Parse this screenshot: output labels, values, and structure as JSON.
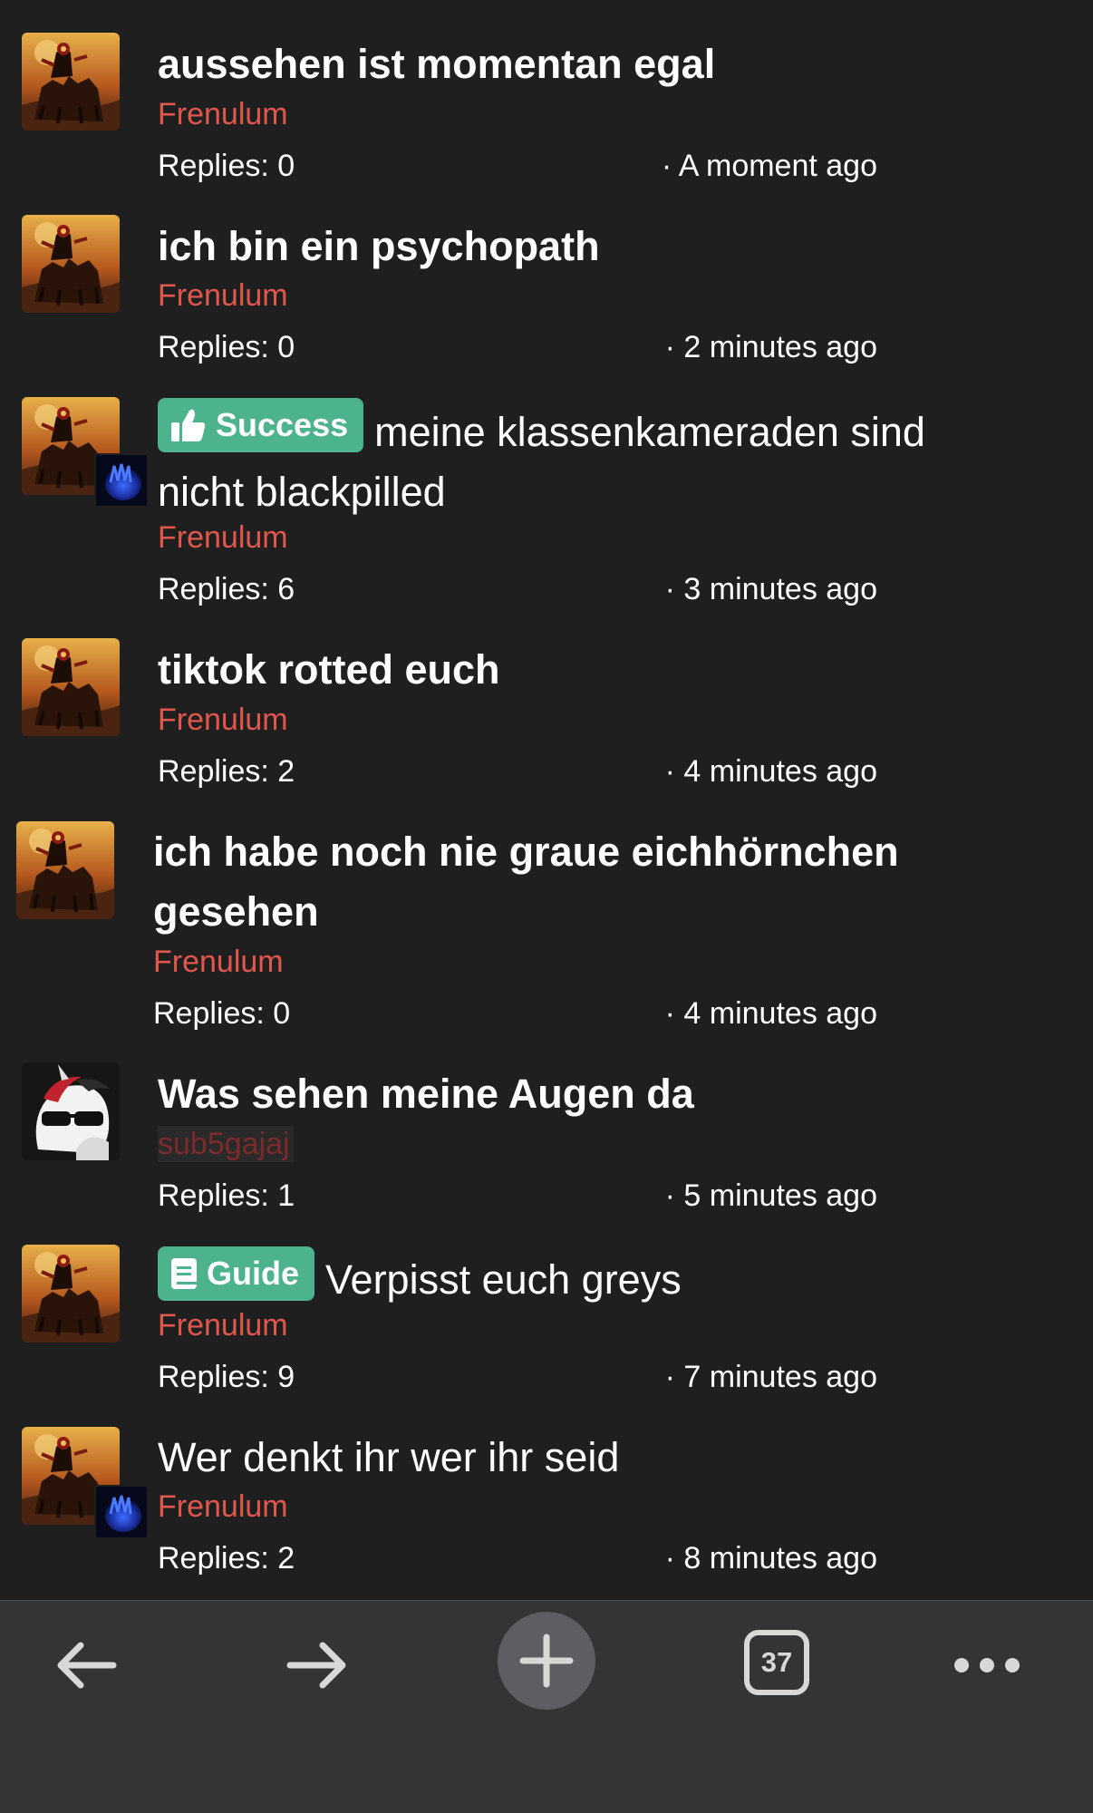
{
  "threads": [
    {
      "title": "aussehen ist momentan egal",
      "author": "Frenulum",
      "replies": "Replies: 0",
      "time": "· A moment ago",
      "avatar": "horseman-avatar"
    },
    {
      "title": "ich bin ein psychopath",
      "author": "Frenulum",
      "replies": "Replies: 0",
      "time": "· 2 minutes ago",
      "avatar": "horseman-avatar"
    },
    {
      "prefix": "Success",
      "prefix_icon": "thumbs-up-icon",
      "title": "meine klassenkameraden sind nicht blackpilled",
      "author": "Frenulum",
      "replies": "Replies: 6",
      "time": "· 3 minutes ago",
      "avatar": "horseman-avatar",
      "sub_avatar": "blue-hand-avatar"
    },
    {
      "title": "tiktok rotted euch",
      "author": "Frenulum",
      "replies": "Replies: 2",
      "time": "· 4 minutes ago",
      "avatar": "horseman-avatar"
    },
    {
      "title": "ich habe noch nie graue eichhörnchen gesehen",
      "author": "Frenulum",
      "replies": "Replies: 0",
      "time": "· 4 minutes ago",
      "avatar": "horseman-avatar"
    },
    {
      "title": "Was sehen meine Augen da",
      "author": "sub5gajaj",
      "replies": "Replies: 1",
      "time": "· 5 minutes ago",
      "avatar": "pony-sunglasses-avatar"
    },
    {
      "prefix": "Guide",
      "prefix_icon": "book-icon",
      "title": "Verpisst euch greys",
      "author": "Frenulum",
      "replies": "Replies: 9",
      "time": "· 7 minutes ago",
      "avatar": "horseman-avatar"
    },
    {
      "title": "Wer denkt ihr wer ihr seid",
      "author": "Frenulum",
      "replies": "Replies: 2",
      "time": "· 8 minutes ago",
      "avatar": "horseman-avatar",
      "sub_avatar": "blue-hand-avatar"
    }
  ],
  "bottom_bar": {
    "back_icon": "arrow-left-icon",
    "forward_icon": "arrow-right-icon",
    "new_icon": "plus-icon",
    "tabs_count": "37",
    "more_icon": "more-dots-icon"
  },
  "colors": {
    "background": "#1f1f20",
    "author": "#e2574c",
    "prefix_badge": "#4db38c",
    "toolbar": "#333436"
  }
}
